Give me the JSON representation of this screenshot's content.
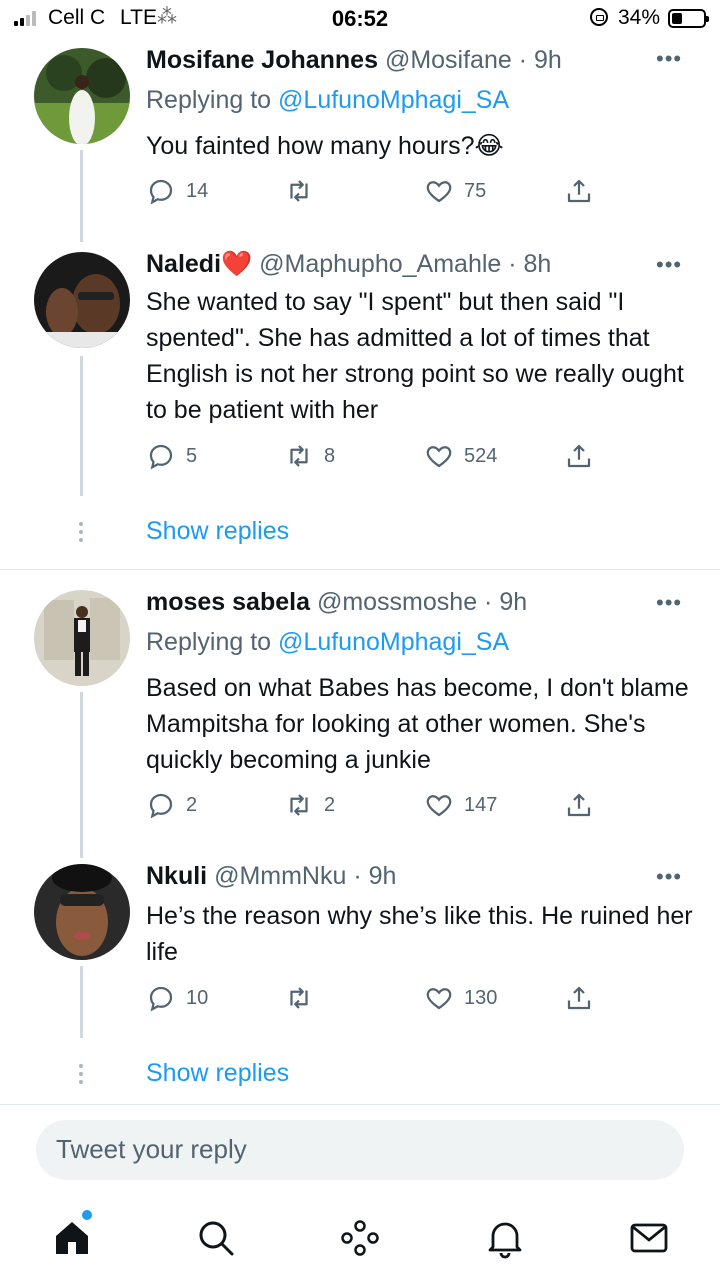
{
  "status_bar": {
    "carrier": "Cell C",
    "network": "LTE",
    "time": "06:52",
    "battery_percent": "34%",
    "battery_level": 0.34
  },
  "tweets": [
    {
      "name": "Mosifane Johannes",
      "handle": "@Mosifane",
      "time": "9h",
      "replying_prefix": "Replying to ",
      "replying_to": "@LufunoMphagi_SA",
      "text": "You fainted how many hours?😂",
      "replies": "14",
      "retweets": "",
      "likes": "75"
    },
    {
      "name": "Naledi❤️",
      "handle": "@Maphupho_Amahle",
      "time": "8h",
      "text": "She wanted to say \"I spent\" but then said \"I spented\". She has admitted a lot of times that English is not her strong point so we really ought to be patient with her",
      "replies": "5",
      "retweets": "8",
      "likes": "524",
      "show_replies": "Show replies"
    },
    {
      "name": "moses sabela",
      "handle": "@mossmoshe",
      "time": "9h",
      "replying_prefix": "Replying to ",
      "replying_to": "@LufunoMphagi_SA",
      "text": "Based on what Babes has become,  I don't blame Mampitsha for looking at other women.  She's quickly becoming a junkie",
      "replies": "2",
      "retweets": "2",
      "likes": "147"
    },
    {
      "name": "Nkuli",
      "handle": "@MmmNku",
      "time": "9h",
      "text": "He’s the reason why she’s like this. He ruined her life",
      "replies": "10",
      "retweets": "",
      "likes": "130",
      "show_replies": "Show replies"
    }
  ],
  "reply_box": {
    "placeholder": "Tweet your reply"
  },
  "nav": [
    "home-icon",
    "search-icon",
    "spaces-icon",
    "notifications-icon",
    "messages-icon"
  ],
  "colors": {
    "accent": "#1d9bf0",
    "muted": "#536471",
    "text": "#0f1419"
  }
}
